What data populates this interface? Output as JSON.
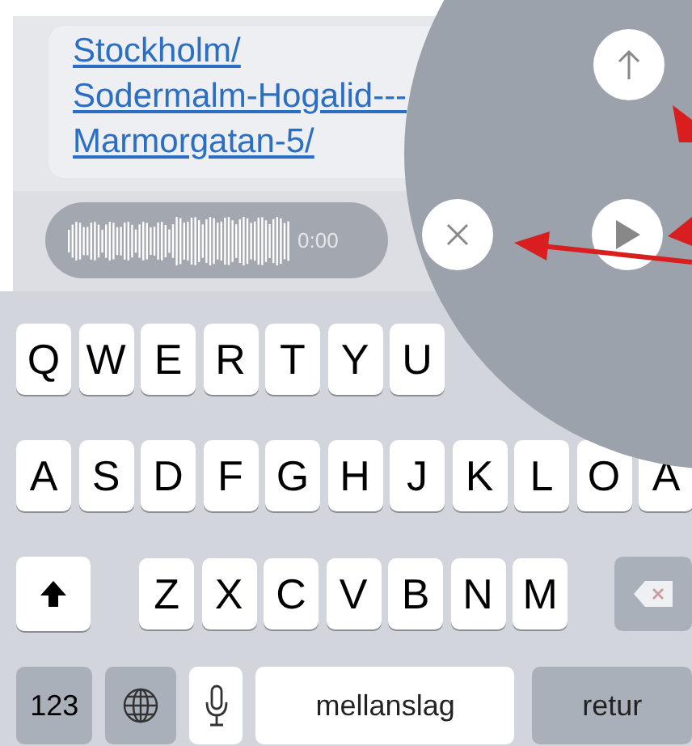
{
  "message": {
    "link_lines": [
      "Stockholm/",
      "Sodermalm-Hogalid---",
      "Marmorgatan-5/"
    ]
  },
  "voice_recording": {
    "time": "0:00"
  },
  "keyboard": {
    "top_letters": [
      "Q",
      "W",
      "E",
      "R",
      "T",
      "Y",
      "U"
    ],
    "home_letters": [
      "A",
      "S",
      "D",
      "F",
      "G",
      "H",
      "J",
      "K",
      "L",
      "O",
      "A"
    ],
    "bottom_letters": [
      "Z",
      "X",
      "C",
      "V",
      "B",
      "N",
      "M"
    ],
    "numbers_key": "123",
    "space_key": "mellanslag",
    "return_key": "retur"
  }
}
